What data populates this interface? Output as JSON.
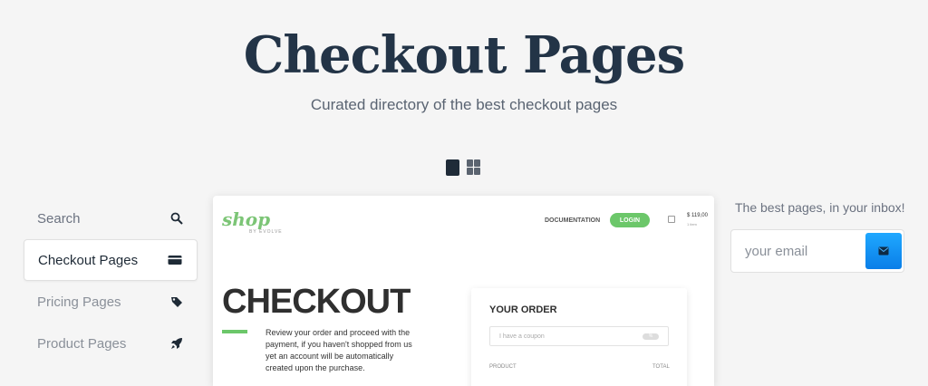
{
  "hero": {
    "title": "Checkout Pages",
    "subtitle": "Curated directory of the best checkout pages"
  },
  "view_toggle": {
    "options": [
      "single-view-icon",
      "grid-view-icon"
    ]
  },
  "sidebar": {
    "items": [
      {
        "label": "Search",
        "icon": "search-icon",
        "active": false
      },
      {
        "label": "Checkout Pages",
        "icon": "credit-card-icon",
        "active": true
      },
      {
        "label": "Pricing Pages",
        "icon": "tags-icon",
        "active": false
      },
      {
        "label": "Product Pages",
        "icon": "rocket-icon",
        "active": false
      }
    ]
  },
  "preview": {
    "logo": "shop",
    "logo_sub": "BY EVOLVE",
    "nav_documentation": "DOCUMENTATION",
    "nav_login": "LOGIN",
    "cart_price": "$ 119,00",
    "cart_items": "1 item",
    "heading": "CHECKOUT",
    "description": "Review your order and proceed with the payment, if you haven't shopped from us yet an account will be automatically created upon the purchase.",
    "order_title": "YOUR ORDER",
    "coupon_placeholder": "I have a coupon",
    "coupon_badge": "%",
    "col_product": "PRODUCT",
    "col_total": "TOTAL"
  },
  "newsletter": {
    "label": "The best pages, in your inbox!",
    "email_placeholder": "your email",
    "send_icon": "envelope-icon"
  },
  "colors": {
    "title": "#233447",
    "accent_green": "#6cc76a",
    "button_blue": "#0a7ee8",
    "background": "#f5f5f5"
  }
}
